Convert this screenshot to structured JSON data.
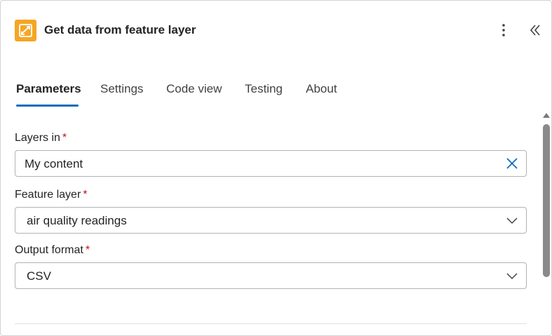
{
  "header": {
    "title": "Get data from feature layer",
    "icon": "feature-layer-app-icon",
    "more_icon": "more-vertical-icon",
    "collapse_icon": "double-chevron-left-icon"
  },
  "tabs": [
    {
      "label": "Parameters",
      "active": true
    },
    {
      "label": "Settings",
      "active": false
    },
    {
      "label": "Code view",
      "active": false
    },
    {
      "label": "Testing",
      "active": false
    },
    {
      "label": "About",
      "active": false
    }
  ],
  "form": {
    "layers_in": {
      "label": "Layers in",
      "required_mark": "*",
      "value": "My content",
      "icon": "close-icon"
    },
    "feature_layer": {
      "label": "Feature layer",
      "required_mark": "*",
      "value": "air quality readings",
      "icon": "chevron-down-icon"
    },
    "output_format": {
      "label": "Output format",
      "required_mark": "*",
      "value": "CSV",
      "icon": "chevron-down-icon"
    }
  },
  "colors": {
    "accent": "#0f6cbd",
    "app_icon_bg": "#f5a623",
    "required": "#c50f1f",
    "border": "#b3b3b3"
  }
}
